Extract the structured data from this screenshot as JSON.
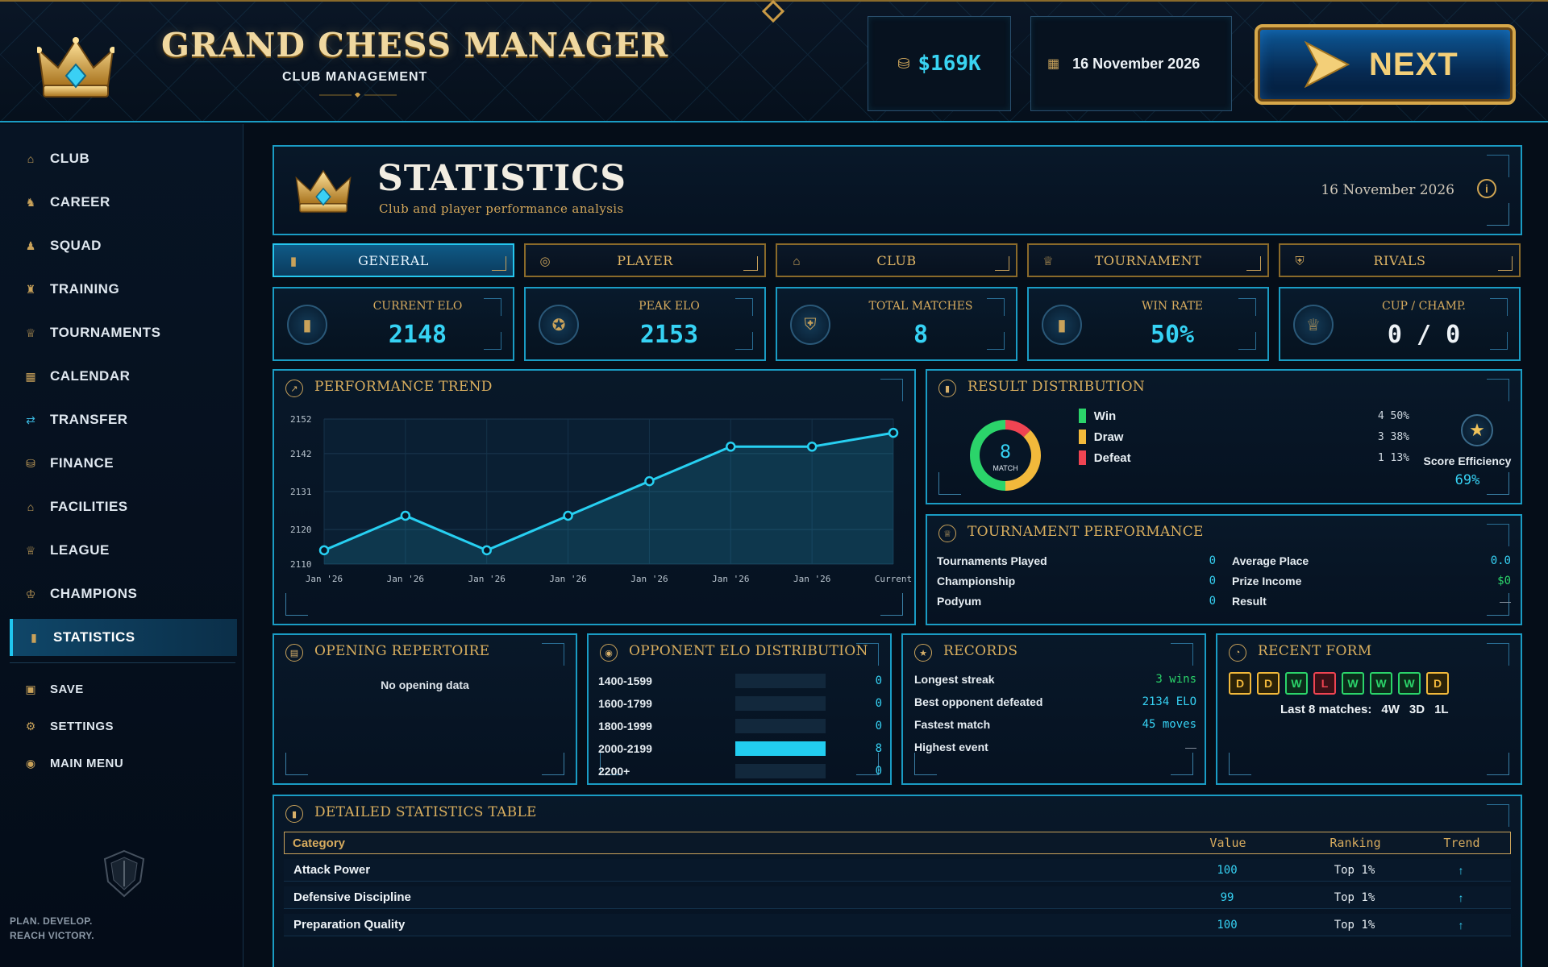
{
  "app": {
    "title": "GRAND CHESS MANAGER",
    "subtitle": "CLUB MANAGEMENT",
    "money": "$169K",
    "date": "16 November 2026",
    "next_label": "NEXT"
  },
  "sidebar": {
    "items": [
      {
        "label": "CLUB",
        "icon": "home-icon"
      },
      {
        "label": "CAREER",
        "icon": "career-icon"
      },
      {
        "label": "SQUAD",
        "icon": "squad-icon"
      },
      {
        "label": "TRAINING",
        "icon": "training-icon"
      },
      {
        "label": "TOURNAMENTS",
        "icon": "trophy-icon"
      },
      {
        "label": "CALENDAR",
        "icon": "calendar-icon"
      },
      {
        "label": "TRANSFER",
        "icon": "transfer-icon"
      },
      {
        "label": "FINANCE",
        "icon": "coins-icon"
      },
      {
        "label": "FACILITIES",
        "icon": "building-icon"
      },
      {
        "label": "LEAGUE",
        "icon": "league-icon"
      },
      {
        "label": "CHAMPIONS",
        "icon": "champions-icon"
      },
      {
        "label": "STATISTICS",
        "icon": "stats-icon"
      }
    ],
    "active": "STATISTICS",
    "secondary": [
      {
        "label": "SAVE",
        "icon": "save-icon"
      },
      {
        "label": "SETTINGS",
        "icon": "gear-icon"
      },
      {
        "label": "MAIN MENU",
        "icon": "menu-icon"
      }
    ],
    "tagline_1": "PLAN. DEVELOP.",
    "tagline_2": "REACH VICTORY."
  },
  "header": {
    "title": "STATISTICS",
    "subtitle": "Club and player performance analysis",
    "date": "16 November 2026"
  },
  "tabs": [
    {
      "label": "GENERAL",
      "icon": "stats-icon",
      "active": true
    },
    {
      "label": "PLAYER",
      "icon": "player-icon",
      "active": false
    },
    {
      "label": "CLUB",
      "icon": "home-icon",
      "active": false
    },
    {
      "label": "TOURNAMENT",
      "icon": "trophy-icon",
      "active": false
    },
    {
      "label": "RIVALS",
      "icon": "shield-icon",
      "active": false
    }
  ],
  "kpis": [
    {
      "label": "CURRENT ELO",
      "value": "2148",
      "icon": "bar-chart-icon"
    },
    {
      "label": "PEAK ELO",
      "value": "2153",
      "icon": "medal-icon"
    },
    {
      "label": "TOTAL MATCHES",
      "value": "8",
      "icon": "shield-icon"
    },
    {
      "label": "WIN RATE",
      "value": "50%",
      "icon": "bar-chart-icon"
    },
    {
      "label": "CUP / CHAMP.",
      "value": "0 / 0",
      "icon": "trophy-icon"
    }
  ],
  "performance": {
    "title": "PERFORMANCE TREND"
  },
  "results": {
    "title": "RESULT DISTRIBUTION",
    "center_value": "8",
    "center_label": "MATCH",
    "rows": [
      {
        "name": "Win",
        "value": "4 50%",
        "color": "#2bd46a"
      },
      {
        "name": "Draw",
        "value": "3 38%",
        "color": "#f2b93b"
      },
      {
        "name": "Defeat",
        "value": "1 13%",
        "color": "#ef4452"
      }
    ],
    "score_label": "Score Efficiency",
    "score_value": "69%"
  },
  "tournament": {
    "title": "TOURNAMENT PERFORMANCE",
    "left": [
      {
        "key": "Tournaments Played",
        "value": "0"
      },
      {
        "key": "Championship",
        "value": "0"
      },
      {
        "key": "Podyum",
        "value": "0"
      }
    ],
    "right": [
      {
        "key": "Average Place",
        "value": "0.0"
      },
      {
        "key": "Prize Income",
        "value": "$0"
      },
      {
        "key": "Result",
        "value": "—"
      }
    ]
  },
  "openings": {
    "title": "OPENING REPERTOIRE",
    "empty": "No opening data"
  },
  "elo_dist": {
    "title": "OPPONENT ELO DISTRIBUTION",
    "max": 8,
    "rows": [
      {
        "range": "1400-1599",
        "count": 0
      },
      {
        "range": "1600-1799",
        "count": 0
      },
      {
        "range": "1800-1999",
        "count": 0
      },
      {
        "range": "2000-2199",
        "count": 8
      },
      {
        "range": "2200+",
        "count": 0
      }
    ]
  },
  "records": {
    "title": "RECORDS",
    "rows": [
      {
        "key": "Longest streak",
        "value": "3 wins"
      },
      {
        "key": "Best opponent defeated",
        "value": "2134 ELO"
      },
      {
        "key": "Fastest match",
        "value": "45 moves"
      },
      {
        "key": "Highest event",
        "value": "—"
      }
    ]
  },
  "form": {
    "title": "RECENT FORM",
    "results": [
      "D",
      "D",
      "W",
      "L",
      "W",
      "W",
      "W",
      "D"
    ],
    "summary_label": "Last 8 matches:",
    "wins": "4W",
    "draws": "3D",
    "losses": "1L"
  },
  "table": {
    "title": "DETAILED STATISTICS TABLE",
    "headers": [
      "Category",
      "Value",
      "Ranking",
      "Trend"
    ],
    "rows": [
      {
        "category": "Attack Power",
        "value": "100",
        "ranking": "Top 1%",
        "trend": "↑"
      },
      {
        "category": "Defensive Discipline",
        "value": "99",
        "ranking": "Top 1%",
        "trend": "↑"
      },
      {
        "category": "Preparation Quality",
        "value": "100",
        "ranking": "Top 1%",
        "trend": "↑"
      }
    ]
  },
  "chart_data": {
    "type": "line",
    "title": "PERFORMANCE TREND",
    "x": [
      "Jan '26",
      "Jan '26",
      "Jan '26",
      "Jan '26",
      "Jan '26",
      "Jan '26",
      "Jan '26",
      "Current"
    ],
    "series": [
      {
        "values": [
          2114,
          2124,
          2114,
          2124,
          2134,
          2144,
          2144,
          2148
        ]
      }
    ],
    "y_ticks": [
      2110,
      2120,
      2131,
      2142,
      2152
    ],
    "ylim": [
      2110,
      2152
    ],
    "grid": true,
    "line_color": "#27d0f2"
  }
}
